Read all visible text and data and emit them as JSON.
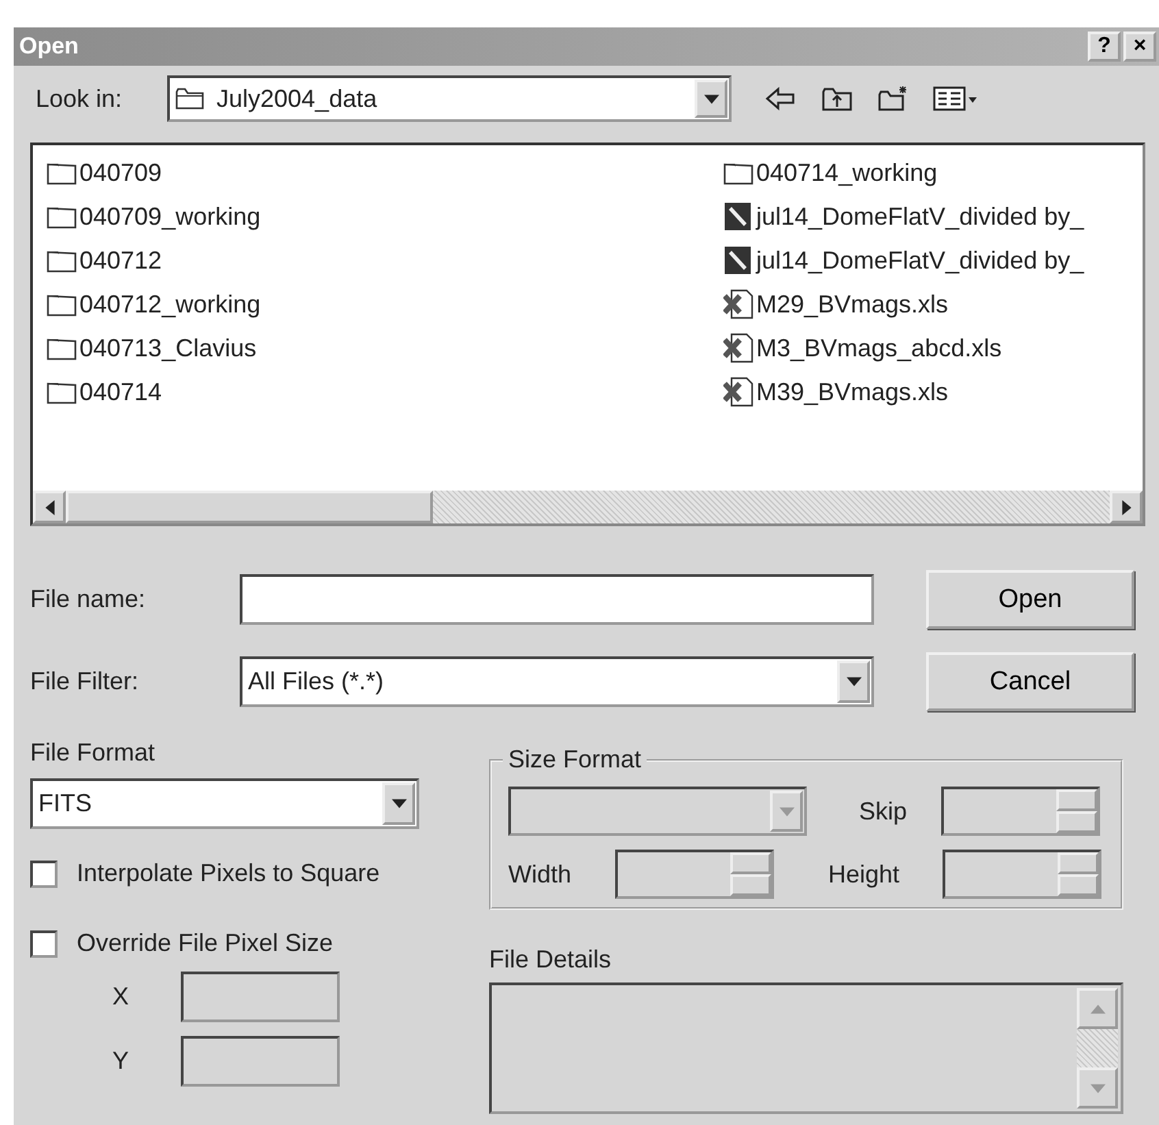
{
  "window": {
    "title": "Open",
    "help_button": "?",
    "close_button": "×"
  },
  "look_in": {
    "label": "Look in:",
    "value": "July2004_data"
  },
  "files": [
    {
      "name": "040709",
      "kind": "folder"
    },
    {
      "name": "040709_working",
      "kind": "folder"
    },
    {
      "name": "040712",
      "kind": "folder"
    },
    {
      "name": "040712_working",
      "kind": "folder"
    },
    {
      "name": "040713_Clavius",
      "kind": "folder"
    },
    {
      "name": "040714",
      "kind": "folder"
    },
    {
      "name": "040714_working",
      "kind": "folder"
    },
    {
      "name": "jul14_DomeFlatV_divided by_",
      "kind": "image"
    },
    {
      "name": "jul14_DomeFlatV_divided by_",
      "kind": "image"
    },
    {
      "name": "M29_BVmags.xls",
      "kind": "excel"
    },
    {
      "name": "M3_BVmags_abcd.xls",
      "kind": "excel"
    },
    {
      "name": "M39_BVmags.xls",
      "kind": "excel"
    }
  ],
  "file_name": {
    "label": "File name:"
  },
  "file_filter": {
    "label": "File Filter:",
    "value": "All Files (*.*)"
  },
  "buttons": [
    "Open",
    "Cancel"
  ],
  "file_format": {
    "label": "File Format",
    "value": "FITS"
  },
  "options": [
    {
      "label": "Interpolate Pixels to Square",
      "checked": false
    },
    {
      "label": "Override File Pixel Size",
      "checked": false
    }
  ],
  "pixel_size": {
    "disabled": true,
    "fields": [
      {
        "label": "X"
      },
      {
        "label": "Y"
      }
    ]
  },
  "size_format": {
    "title": "Size Format",
    "disabled": true,
    "fields": [
      {
        "label": "Skip"
      },
      {
        "label": "Width"
      },
      {
        "label": "Height"
      }
    ]
  },
  "file_details": {
    "label": "File Details"
  }
}
